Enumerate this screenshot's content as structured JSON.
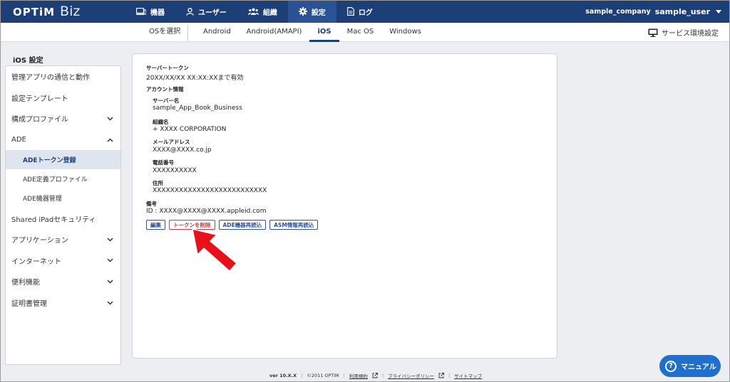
{
  "header": {
    "logo_brand": "OPTiM",
    "logo_product": "Biz",
    "nav": [
      {
        "label": "機器",
        "icon": "device-icon"
      },
      {
        "label": "ユーザー",
        "icon": "user-icon"
      },
      {
        "label": "組織",
        "icon": "group-icon"
      },
      {
        "label": "設定",
        "icon": "gear-icon"
      },
      {
        "label": "ログ",
        "icon": "document-icon"
      }
    ],
    "active_nav": "設定",
    "company": "sample_company",
    "user": "sample_user"
  },
  "subnav": {
    "os_select": "OSを選択",
    "tabs": [
      "Android",
      "Android(AMAPI)",
      "iOS",
      "Mac OS",
      "Windows"
    ],
    "active_tab": "iOS",
    "service_env": "サービス環境設定"
  },
  "sidebar": {
    "title": "iOS 設定",
    "items": [
      {
        "label": "管理アプリの通信と動作"
      },
      {
        "label": "設定テンプレート"
      },
      {
        "label": "構成プロファイル",
        "chevron": "down"
      },
      {
        "label": "ADE",
        "chevron": "up"
      },
      {
        "label": "ADEトークン登録",
        "sub": true,
        "active": true
      },
      {
        "label": "ADE定義プロファイル",
        "sub": true
      },
      {
        "label": "ADE機器管理",
        "sub": true
      },
      {
        "label": "Shared iPadセキュリティ"
      },
      {
        "label": "アプリケーション",
        "chevron": "down"
      },
      {
        "label": "インターネット",
        "chevron": "down"
      },
      {
        "label": "便利機能",
        "chevron": "down"
      },
      {
        "label": "証明書管理",
        "chevron": "down"
      }
    ]
  },
  "main": {
    "server_token_label": "サーバートークン",
    "server_token_value": "20XX/XX/XX XX:XX:XXまで有効",
    "account_info_label": "アカウント情報",
    "server_name_label": "サーバー名",
    "server_name_value": "sample_App_Book_Business",
    "org_name_label": "組織名",
    "org_name_value": "+ XXXX CORPORATION",
    "email_label": "メールアドレス",
    "email_value": "XXXX@XXXX.co.jp",
    "phone_label": "電話番号",
    "phone_value": "XXXXXXXXXX",
    "address_label": "住所",
    "address_value": "XXXXXXXXXXXXXXXXXXXXXXXXXX",
    "notes_label": "備考",
    "notes_value": "ID : XXXX@XXXX@XXXX.appleid.com",
    "buttons": {
      "edit": "編集",
      "delete_token": "トークンを削除",
      "reload_ade": "ADE機器再読込",
      "reload_asm": "ASM情報再読込"
    }
  },
  "footer": {
    "version": "ver 10.X.X",
    "copyright": "©2011 OPTiM",
    "terms": "利用規約",
    "privacy": "プライバシーポリシー",
    "sitemap": "サイトマップ"
  },
  "manual_button": "マニュアル",
  "colors": {
    "header_bg": "#1c3f78",
    "accent": "#2a5395",
    "danger": "#c23a3a",
    "arrow": "#e8101a",
    "manual_bg": "#1f6fcf"
  }
}
